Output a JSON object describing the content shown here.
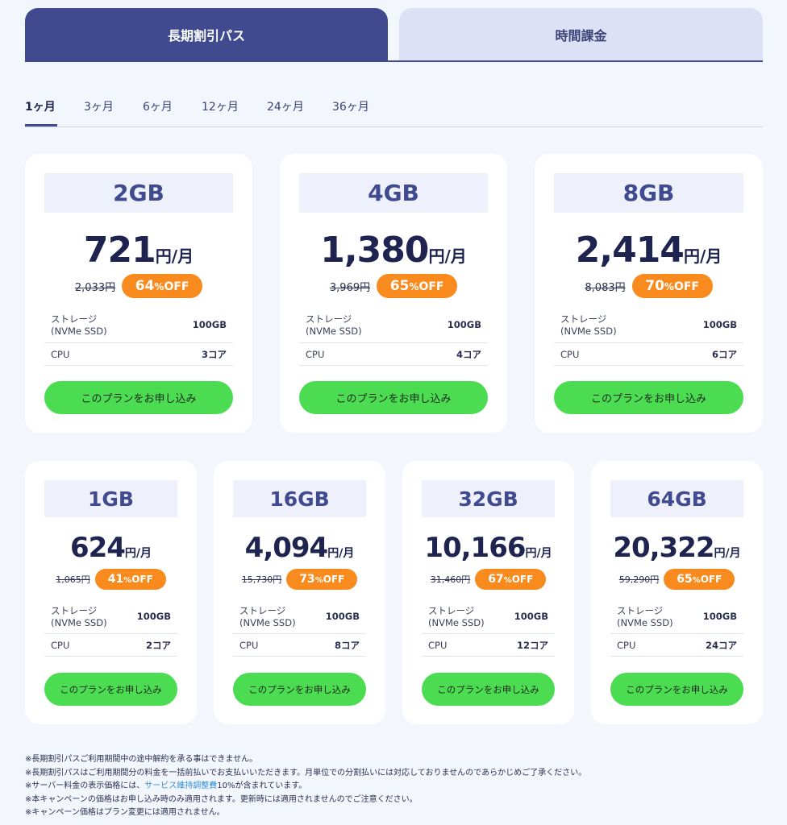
{
  "tabs": {
    "long_term": "長期割引パス",
    "hourly": "時間課金"
  },
  "periods": [
    "1ヶ月",
    "3ヶ月",
    "6ヶ月",
    "12ヶ月",
    "24ヶ月",
    "36ヶ月"
  ],
  "selected_period": "1ヶ月",
  "labels": {
    "storage_line1": "ストレージ",
    "storage_line2": "(NVMe SSD)",
    "cpu": "CPU",
    "apply": "このプランをお申し込み",
    "yen": "円",
    "per_month": "/月",
    "off": "OFF"
  },
  "plans": [
    {
      "capacity": "2GB",
      "price": "721",
      "original": "2,033円",
      "discount_num": "64",
      "discount_pct": "%",
      "storage": "100GB",
      "cpu": "3コア"
    },
    {
      "capacity": "4GB",
      "price": "1,380",
      "original": "3,969円",
      "discount_num": "65",
      "discount_pct": "%",
      "storage": "100GB",
      "cpu": "4コア"
    },
    {
      "capacity": "8GB",
      "price": "2,414",
      "original": "8,083円",
      "discount_num": "70",
      "discount_pct": "%",
      "storage": "100GB",
      "cpu": "6コア"
    },
    {
      "capacity": "1GB",
      "price": "624",
      "original": "1,065円",
      "discount_num": "41",
      "discount_pct": "%",
      "storage": "100GB",
      "cpu": "2コア"
    },
    {
      "capacity": "16GB",
      "price": "4,094",
      "original": "15,730円",
      "discount_num": "73",
      "discount_pct": "%",
      "storage": "100GB",
      "cpu": "8コア"
    },
    {
      "capacity": "32GB",
      "price": "10,166",
      "original": "31,460円",
      "discount_num": "67",
      "discount_pct": "%",
      "storage": "100GB",
      "cpu": "12コア"
    },
    {
      "capacity": "64GB",
      "price": "20,322",
      "original": "59,290円",
      "discount_num": "65",
      "discount_pct": "%",
      "storage": "100GB",
      "cpu": "24コア"
    }
  ],
  "notes": {
    "n1": "※長期割引パスご利用期間中の途中解約を承る事はできません。",
    "n2": "※長期割引パスはご利用期間分の料金を一括前払いでお支払いいただきます。月単位での分割払いには対応しておりませんのであらかじめご了承ください。",
    "n3_pre": "※サーバー料金の表示価格には、",
    "n3_link": "サービス維持調整費",
    "n3_post": "10%が含まれています。",
    "n4": "※本キャンペーンの価格はお申し込み時のみ適用されます。更新時には適用されませんのでご注意ください。",
    "n5": "※キャンペーン価格はプラン変更には適用されません。"
  },
  "colors": {
    "primary": "#3f4a8f",
    "accent_orange": "#f98a1d",
    "cta_green": "#4cdc52",
    "link": "#2f8fd6"
  }
}
